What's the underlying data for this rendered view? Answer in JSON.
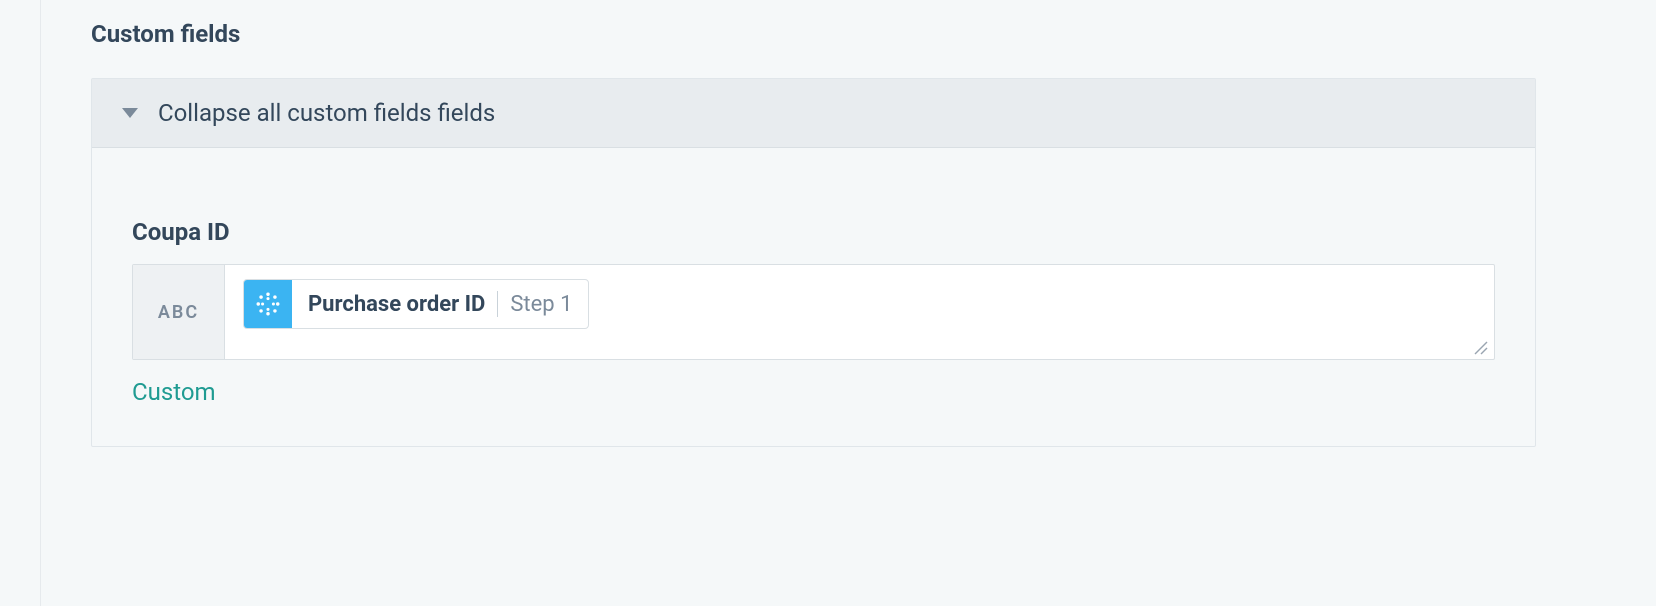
{
  "section": {
    "title": "Custom fields",
    "collapse_label": "Collapse all custom fields fields"
  },
  "field": {
    "label": "Coupa ID",
    "type_badge": "ABC",
    "pill": {
      "main": "Purchase order ID",
      "step": "Step 1"
    },
    "custom_link": "Custom"
  }
}
